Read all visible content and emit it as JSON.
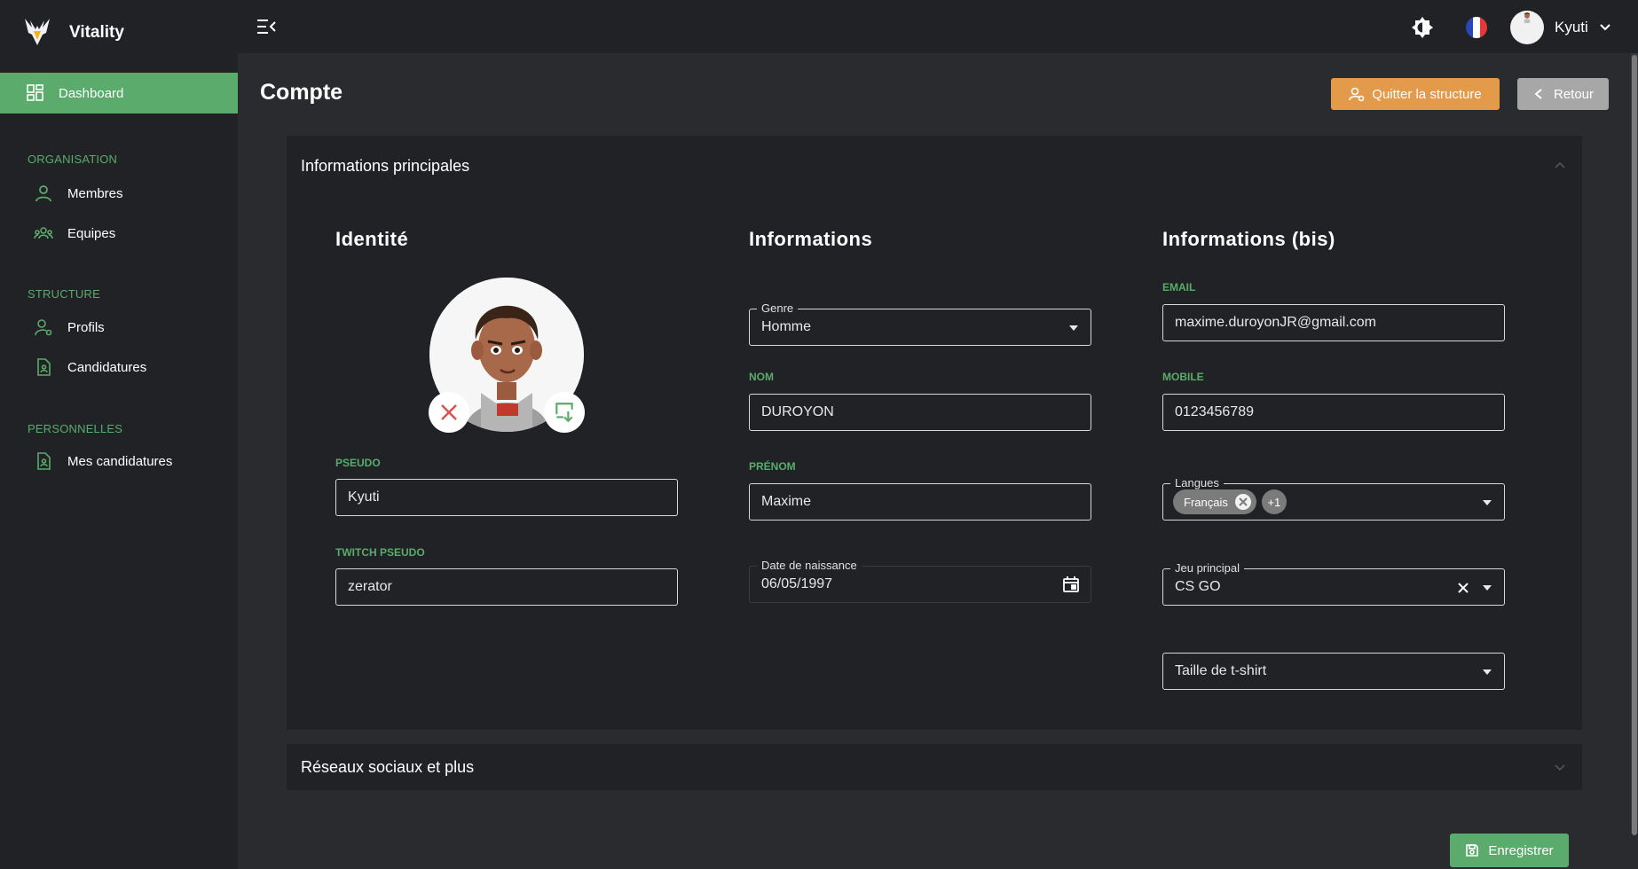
{
  "app": {
    "name": "Vitality"
  },
  "sidebar": {
    "active": {
      "label": "Dashboard",
      "icon": "dashboard-icon"
    },
    "sections": [
      {
        "title": "ORGANISATION",
        "items": [
          {
            "label": "Membres",
            "icon": "user-icon"
          },
          {
            "label": "Equipes",
            "icon": "users-icon"
          }
        ]
      },
      {
        "title": "STRUCTURE",
        "items": [
          {
            "label": "Profils",
            "icon": "user-settings-icon"
          },
          {
            "label": "Candidatures",
            "icon": "document-user-icon"
          }
        ]
      },
      {
        "title": "PERSONNELLES",
        "items": [
          {
            "label": "Mes candidatures",
            "icon": "document-user-icon"
          }
        ]
      }
    ]
  },
  "topbar": {
    "user_name": "Kyuti",
    "flag_colors": [
      "#2b46b5",
      "#ffffff",
      "#e23a3a"
    ]
  },
  "header": {
    "title": "Compte",
    "quit_label": "Quitter la structure",
    "back_label": "Retour"
  },
  "panel_main": {
    "title": "Informations principales",
    "identity": {
      "heading": "Identité",
      "pseudo_label": "PSEUDO",
      "pseudo_value": "Kyuti",
      "twitch_label": "TWITCH PSEUDO",
      "twitch_value": "zerator"
    },
    "info": {
      "heading": "Informations",
      "genre_label": "Genre",
      "genre_value": "Homme",
      "nom_label": "NOM",
      "nom_value": "DUROYON",
      "prenom_label": "PRÉNOM",
      "prenom_value": "Maxime",
      "dob_label": "Date de naissance",
      "dob_value": "06/05/1997"
    },
    "info_bis": {
      "heading": "Informations (bis)",
      "email_label": "EMAIL",
      "email_value": "maxime.duroyonJR@gmail.com",
      "mobile_label": "MOBILE",
      "mobile_value": "0123456789",
      "langues_label": "Langues",
      "langue_chip": "Français",
      "langue_more": "+1",
      "jeu_label": "Jeu principal",
      "jeu_value": "CS GO",
      "tshirt_placeholder": "Taille de t-shirt"
    }
  },
  "panel_social": {
    "title": "Réseaux sociaux et plus"
  },
  "footer": {
    "save_label": "Enregistrer"
  },
  "colors": {
    "accent": "#5aab6c",
    "warning": "#e39a4b",
    "muted": "#a7a7a7",
    "bg": "#2a2b2f",
    "surface": "#212225"
  }
}
